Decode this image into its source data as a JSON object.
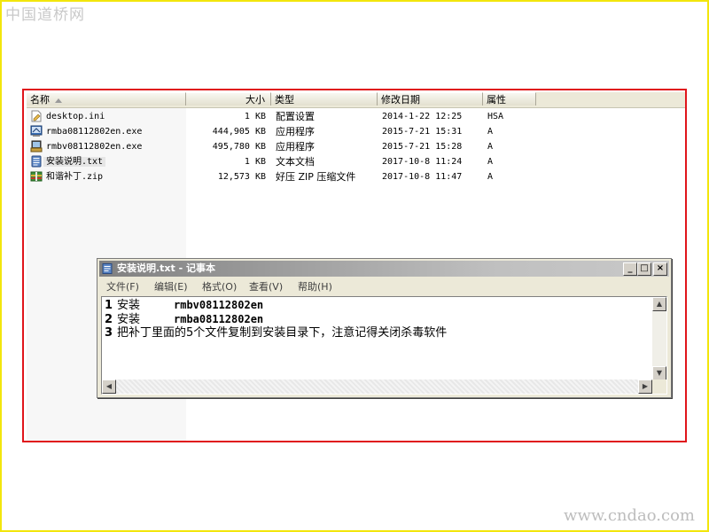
{
  "watermarks": {
    "top": "中国道桥网",
    "bottom": "www.cndao.com"
  },
  "columns": {
    "name": "名称",
    "size": "大小",
    "type": "类型",
    "modified": "修改日期",
    "attr": "属性"
  },
  "files": [
    {
      "name": "desktop.ini",
      "size": "1 KB",
      "type": "配置设置",
      "modified": "2014-1-22 12:25",
      "attr": "HSA",
      "icon": "ini-file-icon"
    },
    {
      "name": "rmba08112802en.exe",
      "size": "444,905 KB",
      "type": "应用程序",
      "modified": "2015-7-21 15:31",
      "attr": "A",
      "icon": "exe-installer-icon"
    },
    {
      "name": "rmbv08112802en.exe",
      "size": "495,780 KB",
      "type": "应用程序",
      "modified": "2015-7-21 15:28",
      "attr": "A",
      "icon": "exe-setup-icon"
    },
    {
      "name": "安装说明.txt",
      "size": "1 KB",
      "type": "文本文档",
      "modified": "2017-10-8 11:24",
      "attr": "A",
      "icon": "text-file-icon"
    },
    {
      "name": "和谐补丁.zip",
      "size": "12,573 KB",
      "type": "好压 ZIP 压缩文件",
      "modified": "2017-10-8 11:47",
      "attr": "A",
      "icon": "zip-archive-icon"
    }
  ],
  "notepad": {
    "title": "安装说明.txt - 记事本",
    "menu": [
      "文件(F)",
      "编辑(E)",
      "格式(O)",
      "查看(V)",
      "帮助(H)"
    ],
    "lines": [
      {
        "num": "1",
        "word": "安装",
        "value": "rmbv08112802en"
      },
      {
        "num": "2",
        "word": "安装",
        "value": "rmba08112802en"
      },
      {
        "num": "3",
        "text": "把补丁里面的5个文件复制到安装目录下，注意记得关闭杀毒软件"
      }
    ],
    "buttons": {
      "minimize": "_",
      "maximize": "□",
      "close": "×"
    }
  }
}
